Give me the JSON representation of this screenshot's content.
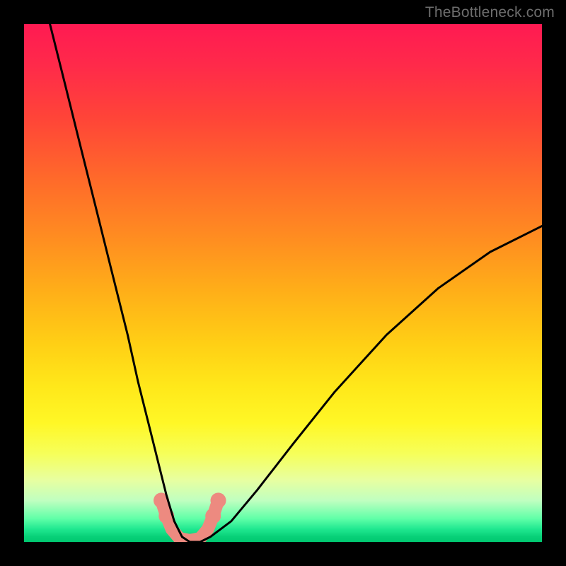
{
  "watermark": "TheBottleneck.com",
  "chart_data": {
    "type": "line",
    "title": "",
    "xlabel": "",
    "ylabel": "",
    "xlim": [
      0,
      100
    ],
    "ylim": [
      0,
      100
    ],
    "grid": false,
    "legend": false,
    "series": [
      {
        "name": "bottleneck-curve",
        "x": [
          5,
          8,
          11,
          14,
          17,
          20,
          22,
          24,
          26,
          27.5,
          29,
          30.5,
          32,
          34,
          36,
          40,
          45,
          52,
          60,
          70,
          80,
          90,
          100
        ],
        "y": [
          100,
          88,
          76,
          64,
          52,
          40,
          31,
          23,
          15,
          9,
          4,
          1,
          0,
          0,
          1,
          4,
          10,
          19,
          29,
          40,
          49,
          56,
          61
        ]
      },
      {
        "name": "highlight-segment",
        "x": [
          26.5,
          27.5,
          28.5,
          30,
          32,
          34,
          35.5,
          36.5,
          37.5
        ],
        "y": [
          8,
          5,
          2.5,
          0.7,
          0.3,
          0.7,
          2.5,
          5,
          8
        ]
      }
    ],
    "colors": {
      "curve": "#000000",
      "highlight": "#ed8a80"
    }
  }
}
